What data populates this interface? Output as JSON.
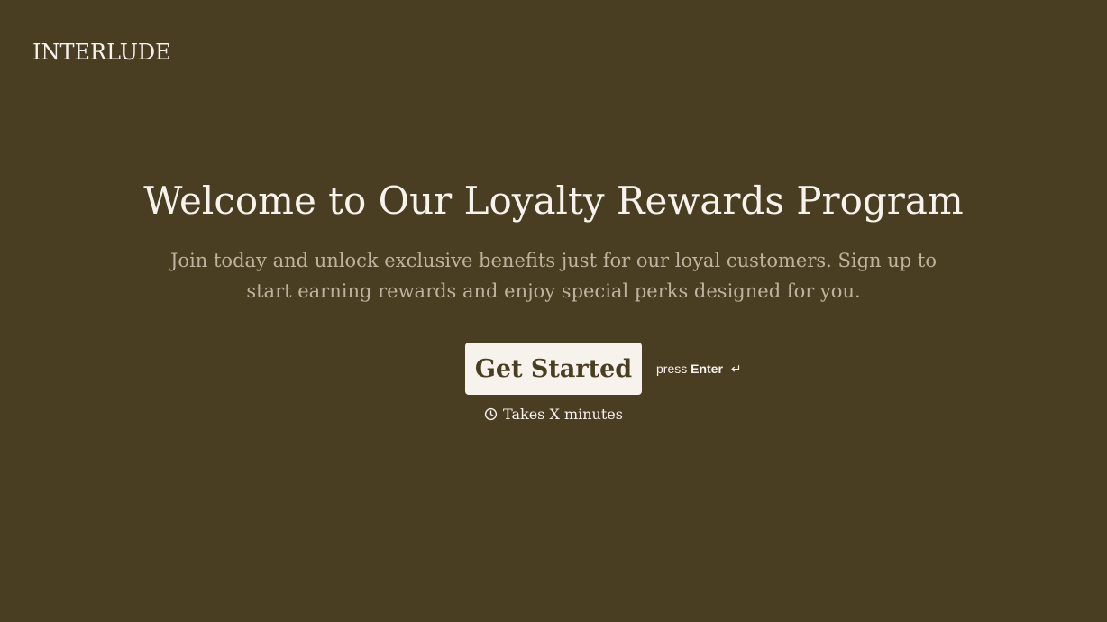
{
  "brand": {
    "name": "INTERLUDE"
  },
  "hero": {
    "title": "Welcome to Our Loyalty Rewards Program",
    "subtitle": "Join today and unlock exclusive benefits just for our loyal customers. Sign up to start earning rewards and enjoy special perks designed for you."
  },
  "cta": {
    "button_label": "Get Started",
    "hint_prefix": "press",
    "hint_key": "Enter",
    "hint_icon": "↵",
    "duration_text": "Takes X minutes"
  },
  "colors": {
    "background": "#493e22",
    "text": "#f7f3ec",
    "muted_text": "#bdb49f",
    "button_bg": "#f7f3ec",
    "button_text": "#493e22"
  },
  "icons": {
    "clock": "clock-icon",
    "enter": "enter-icon"
  }
}
